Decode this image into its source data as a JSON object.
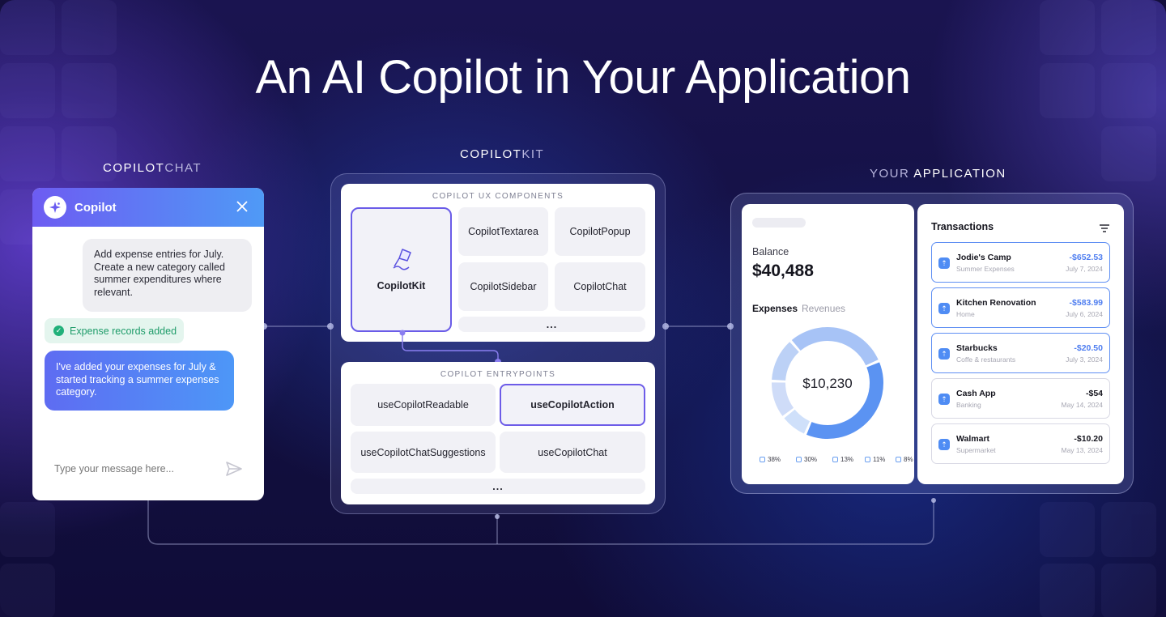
{
  "title": "An AI Copilot in Your Application",
  "labels": {
    "chat_prefix": "COPILOT",
    "chat_suffix": "CHAT",
    "kit_prefix": "COPILOT",
    "kit_suffix": "KIT",
    "app_prefix": "YOUR ",
    "app_suffix": "APPLICATION"
  },
  "chat": {
    "header_title": "Copilot",
    "logo_icon": "sparkle-icon",
    "close_icon": "close-icon",
    "user_message": "Add expense entries for July. Create a new category called summer expenditures where relevant.",
    "status": "Expense records added",
    "bot_message": "I've added your expenses for July & started tracking a summer expenses category.",
    "input_placeholder": "Type your message here...",
    "header_gradient": [
      "#6d5cf2",
      "#4f9af6"
    ]
  },
  "kit": {
    "ux_label": "COPILOT UX COMPONENTS",
    "logo_label": "CopilotKit",
    "ux_components": [
      "CopilotTextarea",
      "CopilotPopup",
      "CopilotSidebar",
      "CopilotChat"
    ],
    "ux_more": "...",
    "entry_label": "COPILOT ENTRYPOINTS",
    "entrypoints": [
      "useCopilotReadable",
      "useCopilotAction",
      "useCopilotChatSuggestions",
      "useCopilotChat"
    ],
    "entry_more": "...",
    "accent_color": "#6d5ce8"
  },
  "app": {
    "balance_label": "Balance",
    "balance_value": "$40,488",
    "tab_active": "Expenses",
    "tab_inactive": "Revenues",
    "donut_total": "$10,230",
    "breakdown": [
      {
        "pct": "38%",
        "value": 38,
        "color": "#5b93f2"
      },
      {
        "pct": "30%",
        "value": 30,
        "color": "#a7c3f6"
      },
      {
        "pct": "13%",
        "value": 13,
        "color": "#bcd1f6"
      },
      {
        "pct": "11%",
        "value": 11,
        "color": "#cfdcf8"
      },
      {
        "pct": "8%",
        "value": 8,
        "color": "#cfe0fa"
      }
    ],
    "transactions_title": "Transactions",
    "transactions": [
      {
        "name": "Jodie's Camp",
        "category": "Summer Expenses",
        "amount": "-$652.53",
        "date": "July 7, 2024",
        "highlight": true
      },
      {
        "name": "Kitchen Renovation",
        "category": "Home",
        "amount": "-$583.99",
        "date": "July 6, 2024",
        "highlight": true
      },
      {
        "name": "Starbucks",
        "category": "Coffe & restaurants",
        "amount": "-$20.50",
        "date": "July 3, 2024",
        "highlight": true
      },
      {
        "name": "Cash App",
        "category": "Banking",
        "amount": "-$54",
        "date": "May 14, 2024",
        "highlight": false
      },
      {
        "name": "Walmart",
        "category": "Supermarket",
        "amount": "-$10.20",
        "date": "May 13, 2024",
        "highlight": false
      }
    ],
    "amount_highlight_color": "#4f7ef0",
    "amount_default_color": "#15151e"
  }
}
